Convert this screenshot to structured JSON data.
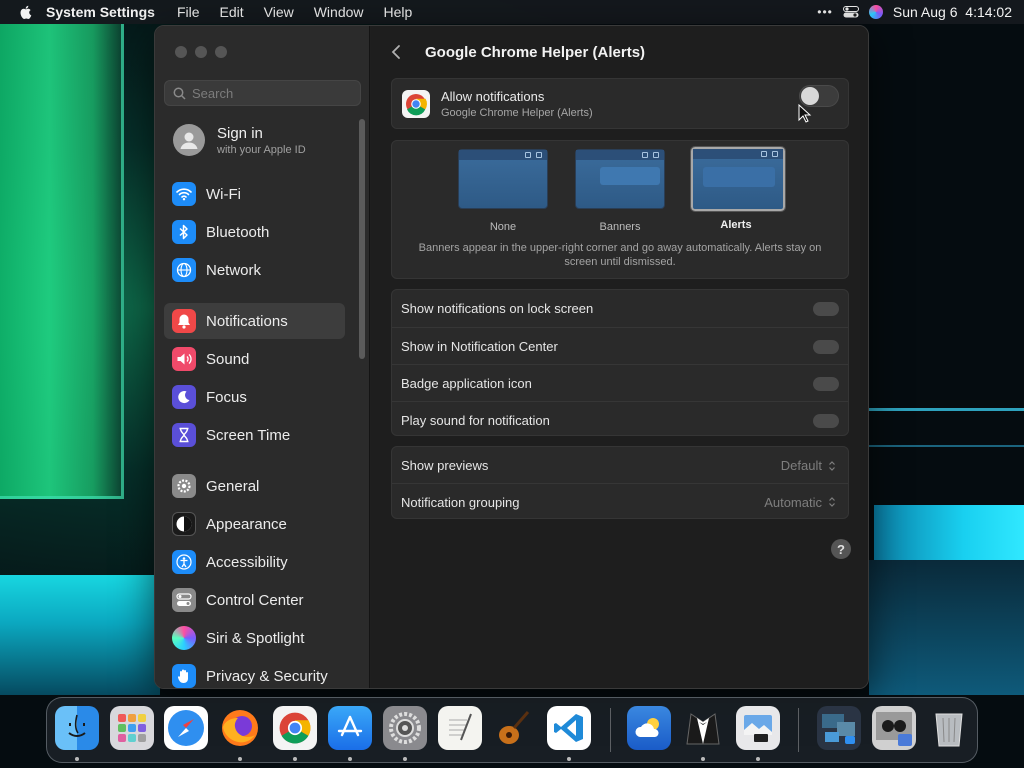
{
  "menubar": {
    "app_name": "System Settings",
    "items": [
      "File",
      "Edit",
      "View",
      "Window",
      "Help"
    ],
    "more": "•••",
    "datetime": "Sun Aug 6  4:14:02"
  },
  "sidebar": {
    "search_placeholder": "Search",
    "signin": {
      "title": "Sign in",
      "subtitle": "with your Apple ID"
    },
    "items": [
      {
        "label": "Wi-Fi",
        "icon": "wifi-icon",
        "color": "#1d8cf8"
      },
      {
        "label": "Bluetooth",
        "icon": "bluetooth-icon",
        "color": "#1d8cf8"
      },
      {
        "label": "Network",
        "icon": "globe-icon",
        "color": "#1d8cf8"
      },
      {
        "label": "Notifications",
        "icon": "bell-icon",
        "color": "#f04848"
      },
      {
        "label": "Sound",
        "icon": "speaker-icon",
        "color": "#f04a6a"
      },
      {
        "label": "Focus",
        "icon": "moon-icon",
        "color": "#5a4fd8"
      },
      {
        "label": "Screen Time",
        "icon": "hourglass-icon",
        "color": "#5a4fd8"
      },
      {
        "label": "General",
        "icon": "gear-icon",
        "color": "#8a8a8a"
      },
      {
        "label": "Appearance",
        "icon": "appearance-icon",
        "color": "#1a1a1a"
      },
      {
        "label": "Accessibility",
        "icon": "accessibility-icon",
        "color": "#1d8cf8"
      },
      {
        "label": "Control Center",
        "icon": "switches-icon",
        "color": "#8a8a8a"
      },
      {
        "label": "Siri & Spotlight",
        "icon": "siri-icon",
        "color": "#222244"
      },
      {
        "label": "Privacy & Security",
        "icon": "hand-icon",
        "color": "#1d8cf8"
      }
    ]
  },
  "main": {
    "title": "Google Chrome Helper (Alerts)",
    "allow": {
      "title": "Allow notifications",
      "subtitle": "Google Chrome Helper (Alerts)",
      "enabled": false
    },
    "styles": {
      "options": [
        "None",
        "Banners",
        "Alerts"
      ],
      "selected": "Alerts",
      "description": "Banners appear in the upper-right corner and go away automatically. Alerts stay on screen until dismissed."
    },
    "toggles": [
      {
        "label": "Show notifications on lock screen",
        "enabled": false
      },
      {
        "label": "Show in Notification Center",
        "enabled": false
      },
      {
        "label": "Badge application icon",
        "enabled": false
      },
      {
        "label": "Play sound for notification",
        "enabled": false
      }
    ],
    "selects": [
      {
        "label": "Show previews",
        "value": "Default"
      },
      {
        "label": "Notification grouping",
        "value": "Automatic"
      }
    ],
    "help": "?"
  },
  "dock": {
    "apps": [
      {
        "name": "Finder",
        "icon": "finder-icon"
      },
      {
        "name": "Launchpad",
        "icon": "launchpad-icon"
      },
      {
        "name": "Safari",
        "icon": "safari-icon"
      },
      {
        "name": "Firefox",
        "icon": "firefox-icon"
      },
      {
        "name": "Google Chrome",
        "icon": "chrome-icon"
      },
      {
        "name": "App Store",
        "icon": "app-store-icon"
      },
      {
        "name": "System Settings",
        "icon": "system-settings-icon"
      },
      {
        "name": "TextEdit",
        "icon": "textedit-icon"
      },
      {
        "name": "GarageBand",
        "icon": "guitar-icon"
      },
      {
        "name": "Visual Studio Code",
        "icon": "vscode-icon"
      },
      {
        "name": "Weather",
        "icon": "weather-icon"
      },
      {
        "name": "Bartender",
        "icon": "tuxedo-icon"
      },
      {
        "name": "Preview",
        "icon": "preview-icon"
      },
      {
        "name": "Recent Folder",
        "icon": "stack-icon"
      },
      {
        "name": "Recent Item",
        "icon": "stack-icon"
      },
      {
        "name": "Trash",
        "icon": "trash-icon"
      }
    ]
  }
}
